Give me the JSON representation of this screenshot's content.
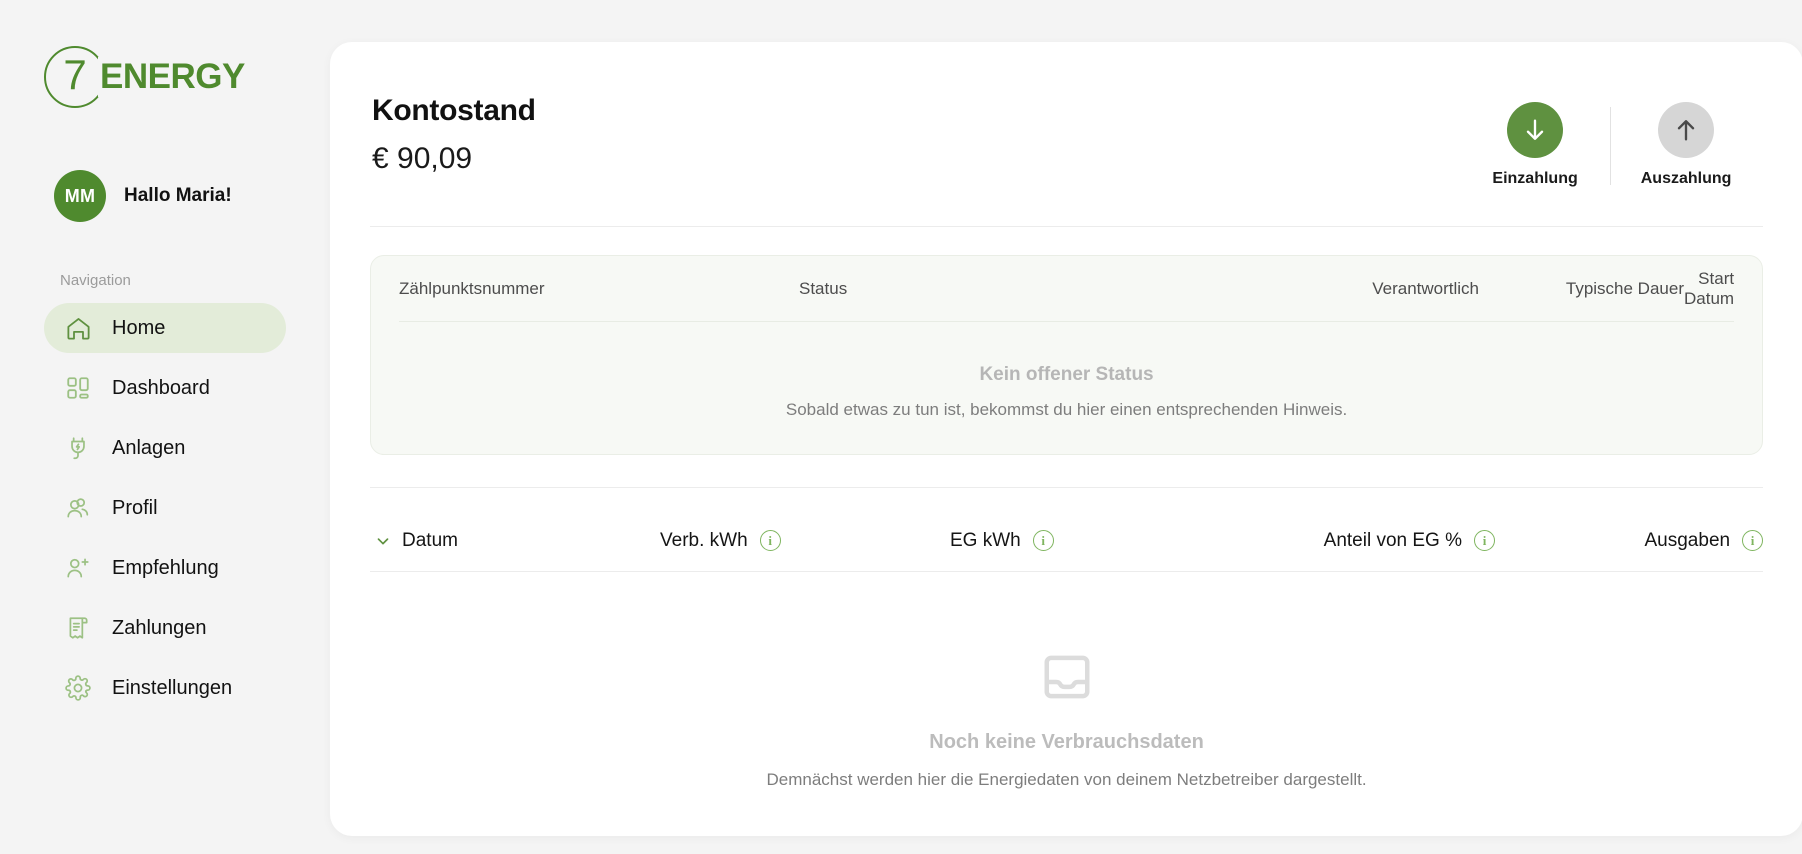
{
  "brand": {
    "logo_numeral": "7",
    "logo_word": "ENERGY",
    "primary_color": "#4f8a2e",
    "accent_light": "#e3ecd9"
  },
  "sidebar": {
    "avatar_initials": "MM",
    "greeting": "Hallo Maria!",
    "nav_label": "Navigation",
    "items": [
      {
        "label": "Home",
        "icon": "home-icon",
        "active": true
      },
      {
        "label": "Dashboard",
        "icon": "dashboard-icon",
        "active": false
      },
      {
        "label": "Anlagen",
        "icon": "plug-icon",
        "active": false
      },
      {
        "label": "Profil",
        "icon": "users-icon",
        "active": false
      },
      {
        "label": "Empfehlung",
        "icon": "user-plus-icon",
        "active": false
      },
      {
        "label": "Zahlungen",
        "icon": "invoice-icon",
        "active": false
      },
      {
        "label": "Einstellungen",
        "icon": "gear-icon",
        "active": false
      }
    ]
  },
  "balance": {
    "title": "Kontostand",
    "amount": "€ 90,09"
  },
  "actions": {
    "deposit": {
      "label": "Einzahlung",
      "icon": "arrow-down-icon",
      "color": "#5f9140"
    },
    "withdraw": {
      "label": "Auszahlung",
      "icon": "arrow-up-icon",
      "color": "#d6d6d6"
    }
  },
  "status_table": {
    "columns": [
      "Zählpunktsnummer",
      "Status",
      "Verantwortlich",
      "Typische Dauer",
      "Start Datum"
    ],
    "empty_title": "Kein offener Status",
    "empty_subtitle": "Sobald etwas zu tun ist, bekommst du hier einen entsprechenden Hinweis."
  },
  "consumption_table": {
    "sort_icon": "chevron-down-icon",
    "columns": [
      {
        "label": "Datum",
        "info": false
      },
      {
        "label": "Verb. kWh",
        "info": true
      },
      {
        "label": "EG kWh",
        "info": true
      },
      {
        "label": "Anteil von EG %",
        "info": true
      },
      {
        "label": "Ausgaben",
        "info": true
      }
    ],
    "info_glyph": "i",
    "empty_icon": "inbox-icon",
    "empty_title": "Noch keine Verbrauchsdaten",
    "empty_subtitle": "Demnächst werden hier die Energiedaten von deinem Netzbetreiber dargestellt."
  }
}
